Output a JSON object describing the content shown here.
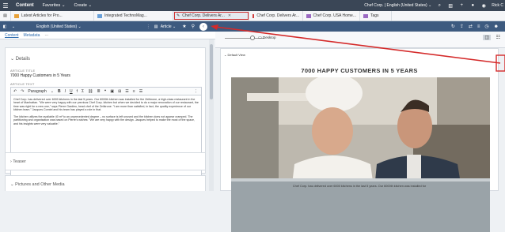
{
  "topbar": {
    "menu_icon": "hamburger-icon",
    "app_title": "Content",
    "favorites": "Favorites ⌄",
    "create": "Create ⌄",
    "site": "Chef Corp. | English (United States) ⌄",
    "user": "Rick C"
  },
  "tabs": [
    {
      "label": "Latest Articles for Pro...",
      "color": "#e8a23a"
    },
    {
      "label": "Integrated TechnoMag...",
      "color": "#6aa0d8"
    },
    {
      "label": "Chef Corp. Delivers Ar...",
      "color": "#3d5a7f"
    },
    {
      "label": "Chef Corp. Delivers Ar...",
      "color": "#d04040"
    },
    {
      "label": "Chef Corp. USA Home...",
      "color": "#9b6ac2"
    },
    {
      "label": "Tags",
      "color": "#9b6ac2"
    }
  ],
  "editor_bar": {
    "locale": "English (United States) ⌄",
    "doctype": "Article ⌄"
  },
  "subtabs": {
    "content": "Content",
    "metadata": "Metadata"
  },
  "preview_bar": {
    "device": "Desktop"
  },
  "form": {
    "section_title": "Details",
    "article_title_label": "ARTICLE TITLE",
    "article_title_value": "7000 Happy Customers in 5 Years",
    "article_text_label": "ARTICLE TEXT",
    "paragraph_style": "Paragraph",
    "body_p1": "Chef Corp. has delivered over 6000 kitchens in the last 5 years. Our 6000th kitchen was installed for the Zeitkrone, a high-class restaurant in the heart of Manhattan. \"We were very happy with our previous Chef Corp. kitchen but when we decided to do a major renovation of our restaurant, the time was right for a new one,\" says Pierre Gardieu, head chef of the Zeitkrone. \"I am more than satisfied, in fact, the quality experience of our kitchen team.\" Jacques Comtel and his team has played a role in that.",
    "body_p2": "The kitchen utilizes the available 40 m² to an unprecedented degree – no surface is left unused and the kitchen does not appear cramped. The partitioning and organisation was based on Pierre's wishes: \"We are very happy with the design. Jacques helped to make the most of the space, and his insights were very valuable.\"",
    "teaser_label": "Teaser",
    "pictures_label": "Pictures and Other Media"
  },
  "preview": {
    "default_view": "Default View",
    "headline": "7000 HAPPY CUSTOMERS IN 5 YEARS",
    "caption": "Chef Corp. has delivered over 6000 kitchens in the last 5 years. Our 6000th kitchen was installed for"
  }
}
